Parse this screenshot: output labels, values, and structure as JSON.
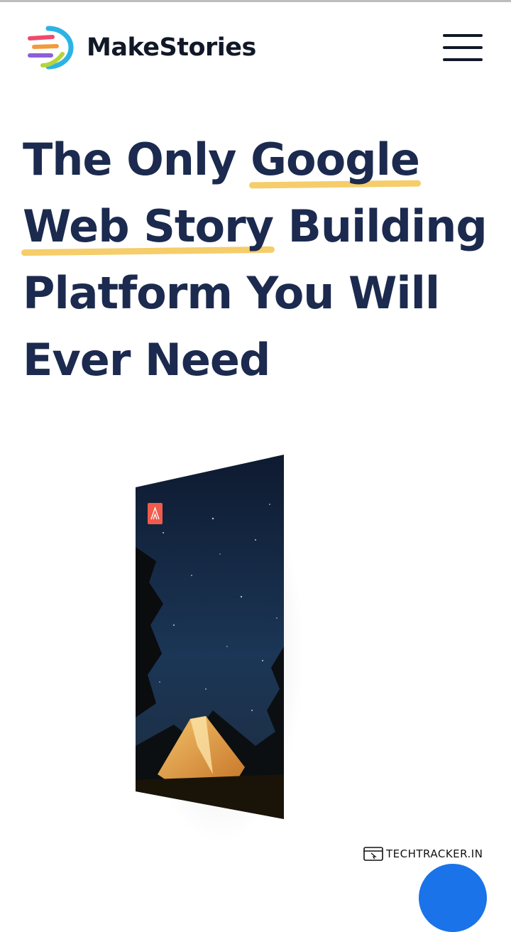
{
  "header": {
    "brand_name": "MakeStories",
    "logo_icon": "makestories-logo-icon",
    "menu_icon": "hamburger-menu-icon"
  },
  "hero": {
    "line1_plain": "The Only ",
    "line1_highlight": "Google",
    "line2_highlight": "Web Story",
    "line2_plain": " Building",
    "line3": "Platform You Will",
    "line4": "Ever Need"
  },
  "story_preview": {
    "badge_icon": "tent-icon",
    "scene": "night camping tent under starry sky"
  },
  "watermark": {
    "text": "TECHTRACKER.IN"
  },
  "colors": {
    "heading": "#1b2a4e",
    "highlight": "#f5cd6a",
    "badge": "#ef5b4c",
    "fab": "#1a73e8"
  }
}
